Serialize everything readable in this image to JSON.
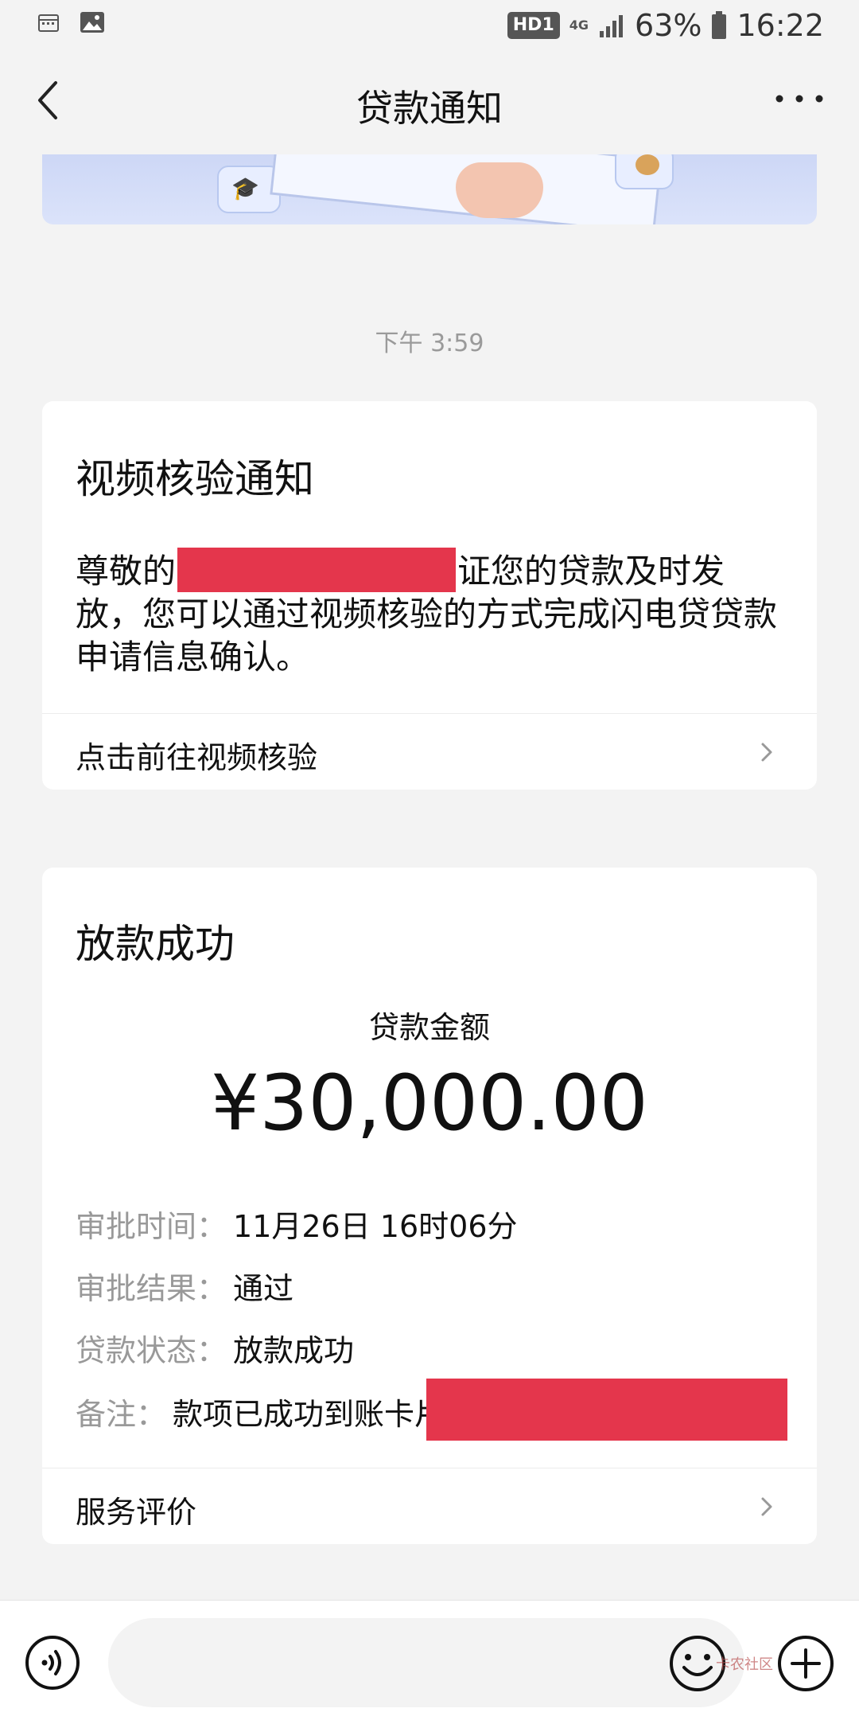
{
  "status_bar": {
    "hd": "HD1",
    "network": "4G",
    "battery": "63%",
    "time": "16:22",
    "icons": [
      "calendar-icon",
      "image-icon",
      "signal-icon",
      "battery-icon"
    ]
  },
  "nav": {
    "title": "贷款通知",
    "back_icon": "chevron-left-icon",
    "more_icon": "more-icon",
    "more_label": "···"
  },
  "timestamp": "下午 3:59",
  "card1": {
    "title": "视频核验通知",
    "body_prefix": "尊敬的",
    "body_suffix": "证您的贷款及时发放，您可以通过视频核验的方式完成闪电贷贷款申请信息确认。",
    "link": "点击前往视频核验"
  },
  "card2": {
    "title": "放款成功",
    "amount_label": "贷款金额",
    "amount": "¥30,000.00",
    "details": [
      {
        "key": "审批时间：",
        "value": "11月26日 16时06分"
      },
      {
        "key": "审批结果：",
        "value": "通过"
      },
      {
        "key": "贷款状态：",
        "value": "放款成功"
      },
      {
        "key": "备注：",
        "value": "款项已成功到账卡片"
      }
    ],
    "link": "服务评价"
  },
  "input_bar": {
    "placeholder": "",
    "watermark": "卡农社区"
  },
  "colors": {
    "redaction": "#e4364c",
    "background": "#f3f3f3",
    "card": "#ffffff",
    "muted_text": "#999999"
  }
}
